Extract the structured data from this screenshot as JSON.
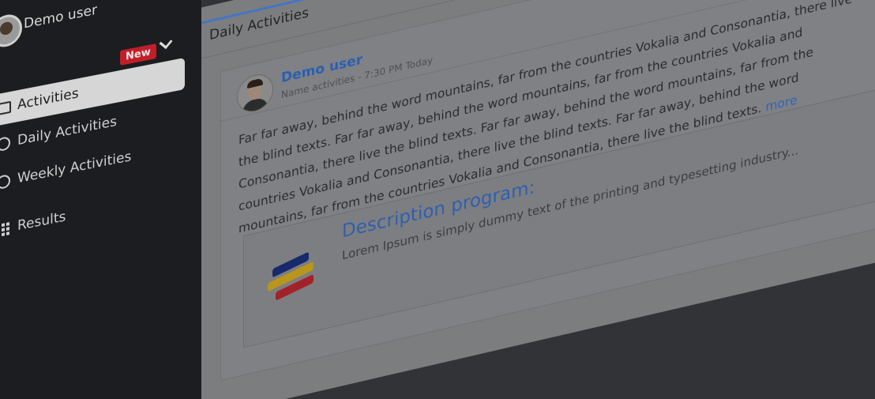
{
  "user": {
    "name": "Demo user"
  },
  "sidebar": {
    "badge": "New",
    "items": [
      {
        "label": "Activities",
        "icon": "monitor-icon",
        "active": true
      },
      {
        "label": "Daily Activities",
        "icon": "circle-icon"
      },
      {
        "label": "Weekly Activities",
        "icon": "circle-icon"
      },
      {
        "label": "Results",
        "icon": "grid-icon"
      }
    ]
  },
  "tab": {
    "label": "Daily Activities"
  },
  "post": {
    "author": "Demo user",
    "meta": "Name activities - 7:30 PM Today",
    "text": "Far far away, behind the word mountains, far from the countries Vokalia and Consonantia, there live the blind texts. Far far away, behind the word mountains, far from the countries Vokalia and Consonantia, there live the blind texts. Far far away, behind the word mountains, far from the countries Vokalia and Consonantia, there live the blind texts. Far far away, behind the word mountains, far from the countries Vokalia and Consonantia, there live the blind texts.",
    "more": "more",
    "attachment": {
      "title": "Description program:",
      "description": "Lorem Ipsum is simply dummy text of the printing and typesetting industry..."
    }
  },
  "colors": {
    "accent": "#2a5cc2",
    "badge": "#c01f2a",
    "sidebar": "#1b1d21"
  }
}
